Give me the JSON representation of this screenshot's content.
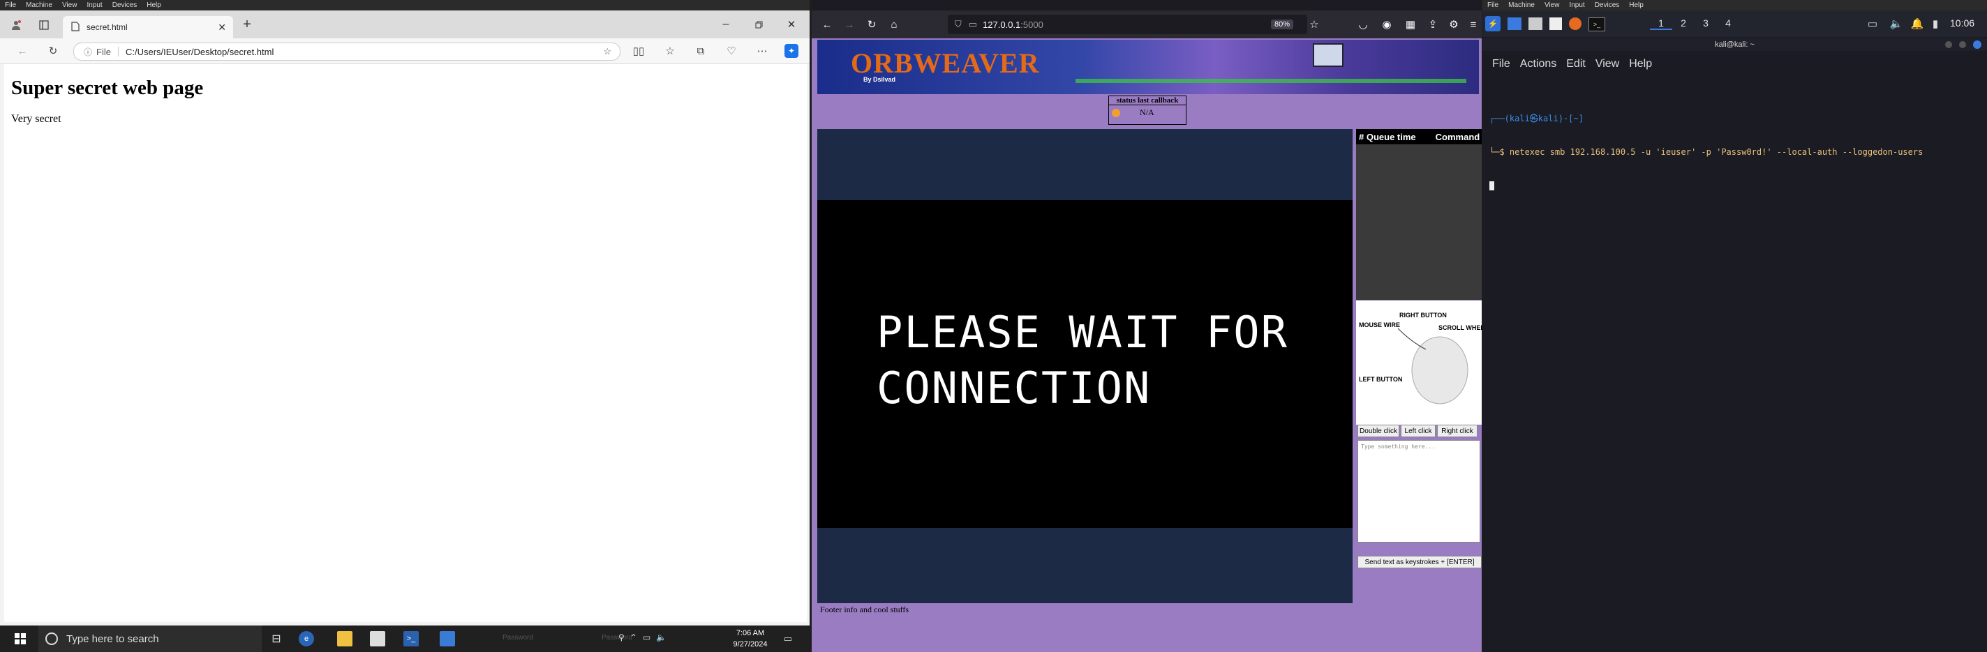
{
  "vbox_menu_left": [
    "File",
    "Machine",
    "View",
    "Input",
    "Devices",
    "Help"
  ],
  "vbox_menu_right": [
    "File",
    "Machine",
    "View",
    "Input",
    "Devices",
    "Help"
  ],
  "windows": {
    "tab_title": "secret.html",
    "address_prefix": "File",
    "url": "C:/Users/IEUser/Desktop/secret.html",
    "page_heading": "Super secret web page",
    "page_text": "Very secret",
    "search_placeholder": "Type here to search",
    "ghost_left": "Password",
    "ghost_right": "Password",
    "clock_time": "7:06 AM",
    "clock_date": "9/27/2024"
  },
  "firefox": {
    "url_host": "127.0.0.1",
    "url_port": ":5000",
    "zoom": "80%",
    "brand": "ORBWEAVER",
    "brand_by": "By Dsilvad",
    "status_title": "status last callback",
    "status_value": "N/A",
    "wait_line1": "PLEASE WAIT FOR",
    "wait_line2": "CONNECTION",
    "queue_col1": "# Queue time",
    "queue_col2": "Command",
    "mouse_labels": {
      "right": "RIGHT BUTTON",
      "wire": "MOUSE WIRE",
      "scroll": "SCROLL WHEEL",
      "left": "LEFT BUTTON"
    },
    "btn_double": "Double click",
    "btn_left": "Left click",
    "btn_right": "Right click",
    "textarea_placeholder": "Type something here...",
    "send_btn": "Send text as keystrokes + [ENTER]",
    "footer": "Footer info and cool stuffs"
  },
  "kali": {
    "workspaces": [
      "1",
      "2",
      "3",
      "4"
    ],
    "clock": "10:06",
    "term_title": "kali@kali: ~",
    "menu": [
      "File",
      "Actions",
      "Edit",
      "View",
      "Help"
    ],
    "prompt_line": "┌──(kali㉿kali)-[~]",
    "command_line": "└─$ netexec smb 192.168.100.5 -u 'ieuser' -p 'Passw0rd!' --local-auth --loggedon-users"
  }
}
